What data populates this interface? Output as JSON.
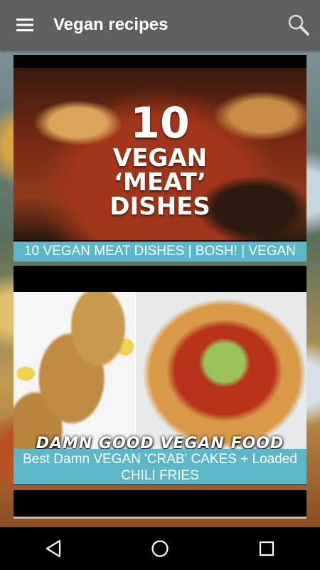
{
  "app_bar": {
    "title": "Vegan recipes",
    "menu_icon": "hamburger-menu-icon",
    "search_icon": "search-icon"
  },
  "videos": [
    {
      "caption": "10 VEGAN MEAT DISHES | BOSH! | VEGAN",
      "thumbnail_text": [
        "10",
        "VEGAN",
        "‘MEAT’",
        "DISHES"
      ]
    },
    {
      "caption": "Best Damn VEGAN 'CRAB' CAKES + Loaded CHILI FRIES",
      "thumbnail_text": [
        "DAMN GOOD VEGAN FOOD"
      ]
    }
  ],
  "nav_bar": {
    "back_icon": "back-triangle-icon",
    "home_icon": "home-circle-icon",
    "recents_icon": "recents-square-icon"
  },
  "colors": {
    "app_bar": "#5f5f5f",
    "caption_bg": "#5cb8c8",
    "nav_bar": "#000000"
  }
}
